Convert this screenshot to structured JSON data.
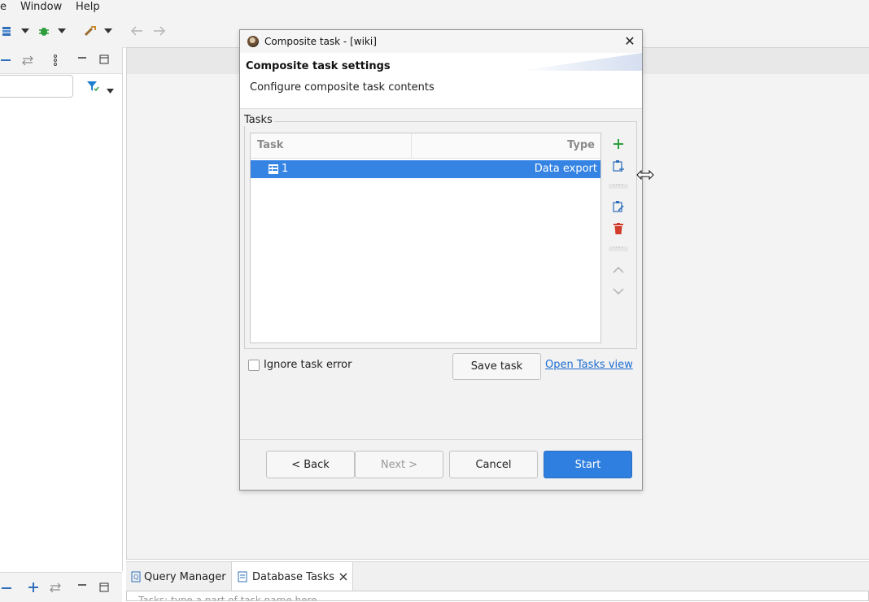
{
  "menubar": {
    "items": [
      "e",
      "Window",
      "Help"
    ]
  },
  "dialog": {
    "title": "Composite task - [wiki]",
    "heading": "Composite task settings",
    "subheading": "Configure composite task contents",
    "tasks_group_label": "Tasks",
    "table": {
      "columns": [
        "Task",
        "Type"
      ],
      "rows": [
        {
          "task": "1",
          "type": "Data export",
          "selected": true
        }
      ]
    },
    "ignore_error_label": "Ignore task error",
    "save_task_label": "Save task",
    "open_tasks_link": "Open Tasks view",
    "buttons": {
      "back": "< Back",
      "next": "Next >",
      "cancel": "Cancel",
      "start": "Start"
    }
  },
  "bottom_tabs": {
    "query_manager": "Query Manager",
    "database_tasks": "Database Tasks"
  },
  "tasks_filter_placeholder": "Tasks: type a part of task name here",
  "colors": {
    "accent": "#3584e4",
    "primary_button": "#2f7fe0",
    "link": "#1c6dd0",
    "add": "#2e9e3e",
    "delete": "#d23c2c"
  }
}
